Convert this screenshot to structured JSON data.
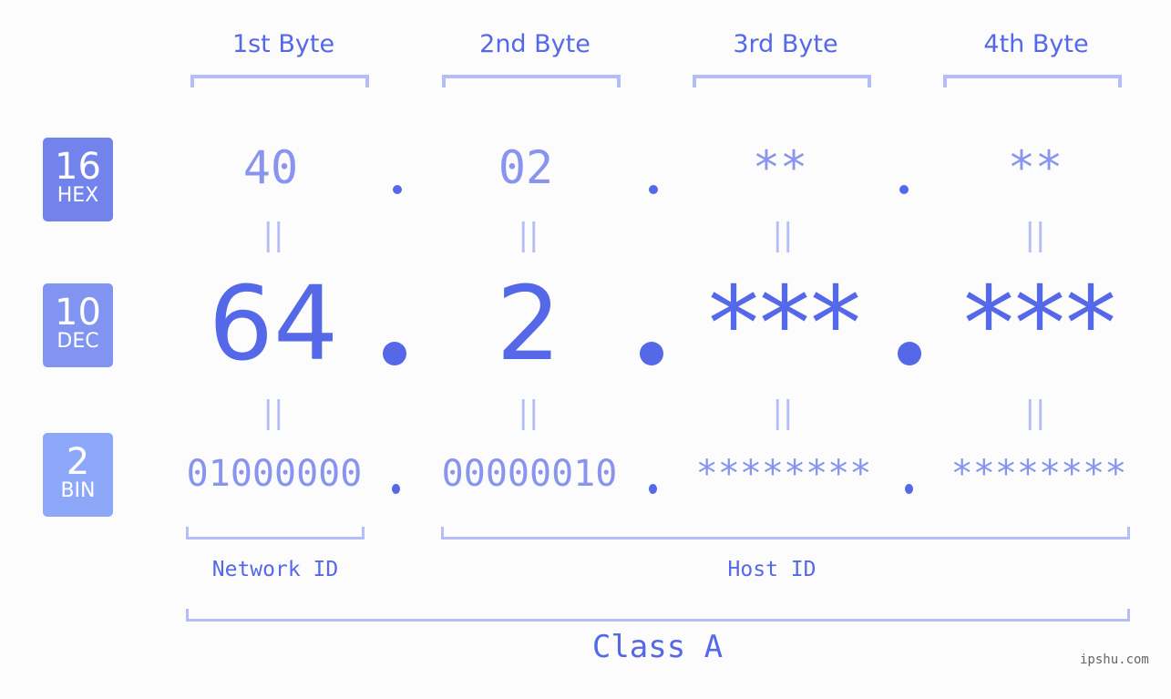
{
  "badges": [
    {
      "number": "16",
      "label": "HEX",
      "color": "#7383ec"
    },
    {
      "number": "10",
      "label": "DEC",
      "color": "#8294f1"
    },
    {
      "number": "2",
      "label": "BIN",
      "color": "#8ea8f9"
    }
  ],
  "bytes": [
    {
      "header": "1st Byte",
      "hex": "40",
      "dec": "64",
      "bin": "01000000"
    },
    {
      "header": "2nd Byte",
      "hex": "02",
      "dec": "2",
      "bin": "00000010"
    },
    {
      "header": "3rd Byte",
      "hex": "**",
      "dec": "***",
      "bin": "********"
    },
    {
      "header": "4th Byte",
      "hex": "**",
      "dec": "***",
      "bin": "********"
    }
  ],
  "equals_glyph": "||",
  "network_id_label": "Network ID",
  "host_id_label": "Host ID",
  "class_label": "Class A",
  "watermark": "ipshu.com",
  "colors": {
    "primary": "#5468e8",
    "secondary": "#8894ee",
    "bracket": "#b4bdf8",
    "background": "#fbfcfb"
  }
}
